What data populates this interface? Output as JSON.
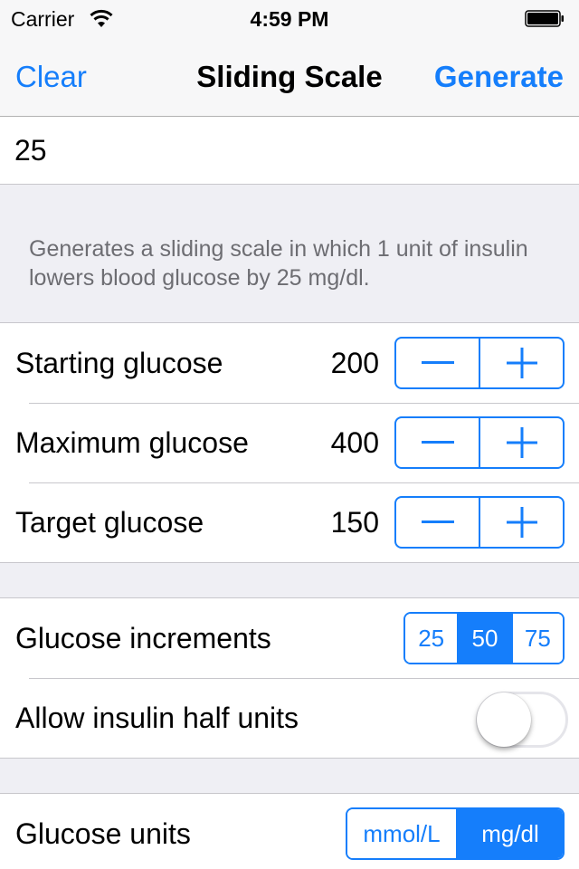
{
  "status_bar": {
    "carrier": "Carrier",
    "wifi_icon": "wifi-icon",
    "time": "4:59 PM",
    "battery_icon": "battery-full-icon"
  },
  "nav": {
    "left_button": "Clear",
    "title": "Sliding Scale",
    "right_button": "Generate"
  },
  "correction_factor": {
    "value": "25"
  },
  "footer_note": "Generates a sliding scale in which 1 unit of insulin lowers blood glucose by 25 mg/dl.",
  "glucose_settings": [
    {
      "label": "Starting glucose",
      "value": "200",
      "minus_icon": "minus-icon",
      "plus_icon": "plus-icon"
    },
    {
      "label": "Maximum glucose",
      "value": "400",
      "minus_icon": "minus-icon",
      "plus_icon": "plus-icon"
    },
    {
      "label": "Target glucose",
      "value": "150",
      "minus_icon": "minus-icon",
      "plus_icon": "plus-icon"
    }
  ],
  "options": {
    "increments": {
      "label": "Glucose increments",
      "options": [
        "25",
        "50",
        "75"
      ],
      "selected": "50"
    },
    "half_units": {
      "label": "Allow insulin half units",
      "on": false
    }
  },
  "units": {
    "label": "Glucose units",
    "options": [
      "mmol/L",
      "mg/dl"
    ],
    "selected": "mg/dl"
  },
  "colors": {
    "accent": "#157efb",
    "background": "#efeff4",
    "footer_text": "#6d6d72",
    "separator": "#c8c7cc"
  }
}
